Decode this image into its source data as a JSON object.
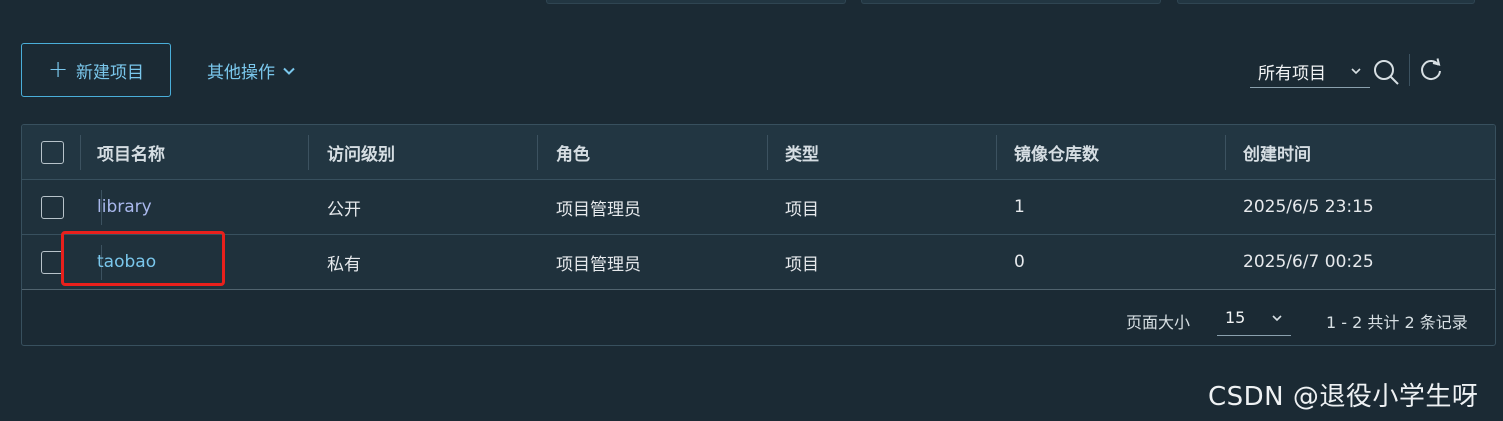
{
  "toolbar": {
    "new_project_label": "新建项目",
    "other_actions_label": "其他操作",
    "filter_selected": "所有项目"
  },
  "table": {
    "columns": [
      "项目名称",
      "访问级别",
      "角色",
      "类型",
      "镜像仓库数",
      "创建时间"
    ],
    "rows": [
      {
        "name": "library",
        "access": "公开",
        "role": "项目管理员",
        "type": "项目",
        "repo_count": "1",
        "created": "2025/6/5 23:15"
      },
      {
        "name": "taobao",
        "access": "私有",
        "role": "项目管理员",
        "type": "项目",
        "repo_count": "0",
        "created": "2025/6/7 00:25"
      }
    ]
  },
  "pagination": {
    "page_size_label": "页面大小",
    "page_size_value": "15",
    "range_text": "1 - 2 共计 2 条记录"
  },
  "watermark": "CSDN @退役小学生呀",
  "colors": {
    "background": "#1b2a34",
    "accent": "#7ac7ec",
    "highlight": "#e9201c"
  }
}
